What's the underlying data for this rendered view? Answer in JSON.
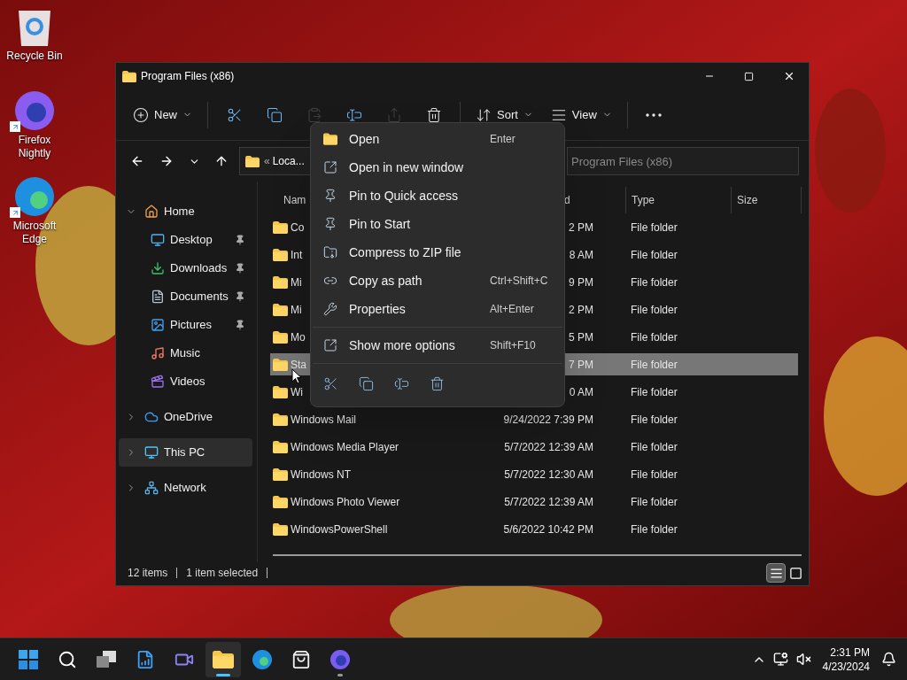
{
  "desktop_icons": [
    {
      "kind": "recycle",
      "label": "Recycle Bin",
      "shortcut": false
    },
    {
      "kind": "firefox",
      "label": "Firefox Nightly",
      "shortcut": true
    },
    {
      "kind": "edge",
      "label": "Microsoft Edge",
      "shortcut": true
    }
  ],
  "window": {
    "title": "Program Files (x86)"
  },
  "toolbar": [
    {
      "kind": "new",
      "label": "New",
      "disabled": false
    },
    {
      "kind": "cut",
      "disabled": false
    },
    {
      "kind": "copy",
      "disabled": false
    },
    {
      "kind": "paste",
      "disabled": true
    },
    {
      "kind": "rename",
      "disabled": false
    },
    {
      "kind": "share",
      "disabled": true
    },
    {
      "kind": "delete",
      "disabled": false
    },
    {
      "kind": "sort",
      "label": "Sort",
      "disabled": false
    },
    {
      "kind": "view",
      "label": "View",
      "disabled": false
    },
    {
      "kind": "more",
      "disabled": false
    }
  ],
  "address": {
    "separator": "«",
    "path": "Loca..."
  },
  "search": {
    "placeholder": "Program Files (x86)"
  },
  "nav": [
    {
      "kind": "home",
      "label": "Home",
      "expanded": true,
      "selected": false,
      "children": [
        {
          "kind": "desktop",
          "label": "Desktop",
          "pinned": true,
          "selected": false
        },
        {
          "kind": "downloads",
          "label": "Downloads",
          "pinned": true,
          "selected": false
        },
        {
          "kind": "documents",
          "label": "Documents",
          "pinned": true,
          "selected": false
        },
        {
          "kind": "pictures",
          "label": "Pictures",
          "pinned": true,
          "selected": false
        },
        {
          "kind": "music",
          "label": "Music",
          "pinned": false,
          "selected": false
        },
        {
          "kind": "videos",
          "label": "Videos",
          "pinned": false,
          "selected": false
        }
      ]
    },
    {
      "kind": "onedrive",
      "label": "OneDrive",
      "expanded": false,
      "selected": false
    },
    {
      "kind": "pc",
      "label": "This PC",
      "expanded": false,
      "selected": true
    },
    {
      "kind": "network",
      "label": "Network",
      "expanded": false,
      "selected": false
    }
  ],
  "columns": [
    {
      "label": "Nam"
    },
    {
      "label": "d"
    },
    {
      "label": "Type"
    },
    {
      "label": "Size"
    }
  ],
  "rows": [
    {
      "name": "Co",
      "date": "2 PM",
      "type": "File folder",
      "selected": false
    },
    {
      "name": "Int",
      "date": "8 AM",
      "type": "File folder",
      "selected": false
    },
    {
      "name": "Mi",
      "date": "9 PM",
      "type": "File folder",
      "selected": false
    },
    {
      "name": "Mi",
      "date": "2 PM",
      "type": "File folder",
      "selected": false
    },
    {
      "name": "Mo",
      "date": "5 PM",
      "type": "File folder",
      "selected": false
    },
    {
      "name": "Sta",
      "date": "7 PM",
      "type": "File folder",
      "selected": true
    },
    {
      "name": "Wi",
      "date": "0 AM",
      "type": "File folder",
      "selected": false
    },
    {
      "name": "Windows Mail",
      "date": "9/24/2022 7:39 PM",
      "type": "File folder",
      "selected": false
    },
    {
      "name": "Windows Media Player",
      "date": "5/7/2022 12:39 AM",
      "type": "File folder",
      "selected": false
    },
    {
      "name": "Windows NT",
      "date": "5/7/2022 12:30 AM",
      "type": "File folder",
      "selected": false
    },
    {
      "name": "Windows Photo Viewer",
      "date": "5/7/2022 12:39 AM",
      "type": "File folder",
      "selected": false
    },
    {
      "name": "WindowsPowerShell",
      "date": "5/6/2022 10:42 PM",
      "type": "File folder",
      "selected": false
    }
  ],
  "context_menu": {
    "items": [
      {
        "kind": "open",
        "label": "Open",
        "shortcut": "Enter"
      },
      {
        "kind": "open-window",
        "label": "Open in new window"
      },
      {
        "kind": "pin",
        "label": "Pin to Quick access"
      },
      {
        "kind": "pin",
        "label": "Pin to Start"
      },
      {
        "kind": "zip",
        "label": "Compress to ZIP file"
      },
      {
        "kind": "copy-path",
        "label": "Copy as path",
        "shortcut": "Ctrl+Shift+C"
      },
      {
        "kind": "properties",
        "label": "Properties",
        "shortcut": "Alt+Enter"
      }
    ],
    "more": [
      {
        "kind": "more-options",
        "label": "Show more options",
        "shortcut": "Shift+F10"
      }
    ],
    "actions": [
      {
        "kind": "cut"
      },
      {
        "kind": "copy"
      },
      {
        "kind": "rename"
      },
      {
        "kind": "delete"
      }
    ]
  },
  "status_bar": {
    "count": "12 items",
    "selection": "1 item selected",
    "views": [
      {
        "kind": "details",
        "selected": true
      },
      {
        "kind": "tiles",
        "selected": false
      }
    ]
  },
  "taskbar": {
    "apps": [
      {
        "kind": "start",
        "active": false,
        "running": false
      },
      {
        "kind": "search",
        "active": false,
        "running": false
      },
      {
        "kind": "taskview",
        "active": false,
        "running": false
      },
      {
        "kind": "doc",
        "active": false,
        "running": false
      },
      {
        "kind": "chat",
        "active": false,
        "running": false
      },
      {
        "kind": "explorer",
        "active": true,
        "running": true
      },
      {
        "kind": "edge",
        "active": false,
        "running": false
      },
      {
        "kind": "store",
        "active": false,
        "running": false
      },
      {
        "kind": "firefox",
        "active": false,
        "running": true
      }
    ],
    "time": "2:31 PM",
    "date": "4/23/2024"
  }
}
